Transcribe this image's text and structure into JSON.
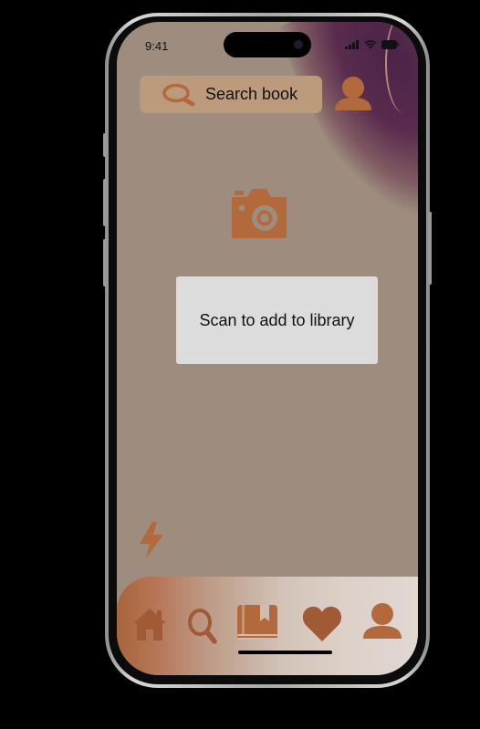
{
  "status_bar": {
    "time": "9:41"
  },
  "search": {
    "label": "Search book",
    "icon": "search-icon"
  },
  "header": {
    "profile_icon": "user-icon"
  },
  "scan": {
    "camera_icon": "camera-icon",
    "prompt": "Scan to add to library",
    "flash_icon": "flash-icon"
  },
  "bottom_nav": {
    "items": [
      {
        "name": "home",
        "icon": "home-icon"
      },
      {
        "name": "search",
        "icon": "search-icon"
      },
      {
        "name": "library",
        "icon": "book-icon"
      },
      {
        "name": "favorites",
        "icon": "heart-icon"
      },
      {
        "name": "profile",
        "icon": "user-icon"
      }
    ]
  },
  "colors": {
    "screen_background": "#9e8d7f",
    "accent": "#b26a3d",
    "search_bar": "#bc9a7c",
    "card": "#dcdcdc",
    "corner_decoration": "#4a2448"
  }
}
